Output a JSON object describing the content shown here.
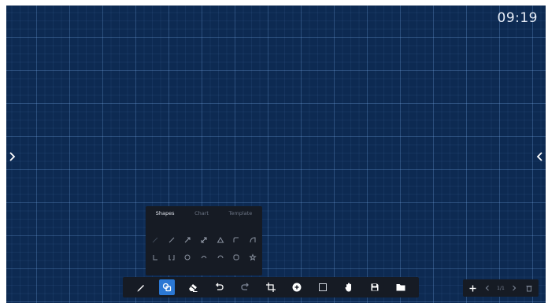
{
  "clock": {
    "time": "09:19"
  },
  "shape_panel": {
    "tabs": [
      {
        "label": "Shapes",
        "active": true
      },
      {
        "label": "Chart",
        "active": false
      },
      {
        "label": "Template",
        "active": false
      }
    ],
    "row1_icons": [
      "line-icon",
      "line-icon",
      "arrow-icon",
      "arrow-icon",
      "triangle-icon",
      "rounded-corner-icon",
      "arc-icon"
    ],
    "row2_icons": [
      "bracket-icon",
      "double-bracket-icon",
      "circle-icon",
      "curve-icon",
      "oval-icon",
      "rounded-square-icon",
      "star-icon"
    ]
  },
  "toolbar": {
    "tools": [
      {
        "name": "pen",
        "icon": "pen-icon",
        "active": false
      },
      {
        "name": "shapes",
        "icon": "shapes-icon",
        "active": true
      },
      {
        "name": "eraser",
        "icon": "eraser-icon",
        "active": false
      },
      {
        "name": "undo",
        "icon": "undo-icon",
        "active": false
      },
      {
        "name": "redo",
        "icon": "redo-icon",
        "active": false
      },
      {
        "name": "crop",
        "icon": "crop-icon",
        "active": false
      },
      {
        "name": "insert",
        "icon": "plus-circle-icon",
        "active": false
      },
      {
        "name": "select",
        "icon": "selection-box-icon",
        "active": false
      },
      {
        "name": "pan",
        "icon": "hand-icon",
        "active": false
      },
      {
        "name": "save",
        "icon": "save-icon",
        "active": false
      },
      {
        "name": "open",
        "icon": "folder-icon",
        "active": false
      }
    ],
    "active_color": "#2b78d4"
  },
  "pager": {
    "page_count": "1/1"
  },
  "colors": {
    "board": "#0d2a52",
    "panel": "#161b24",
    "accent": "#2b78d4"
  }
}
